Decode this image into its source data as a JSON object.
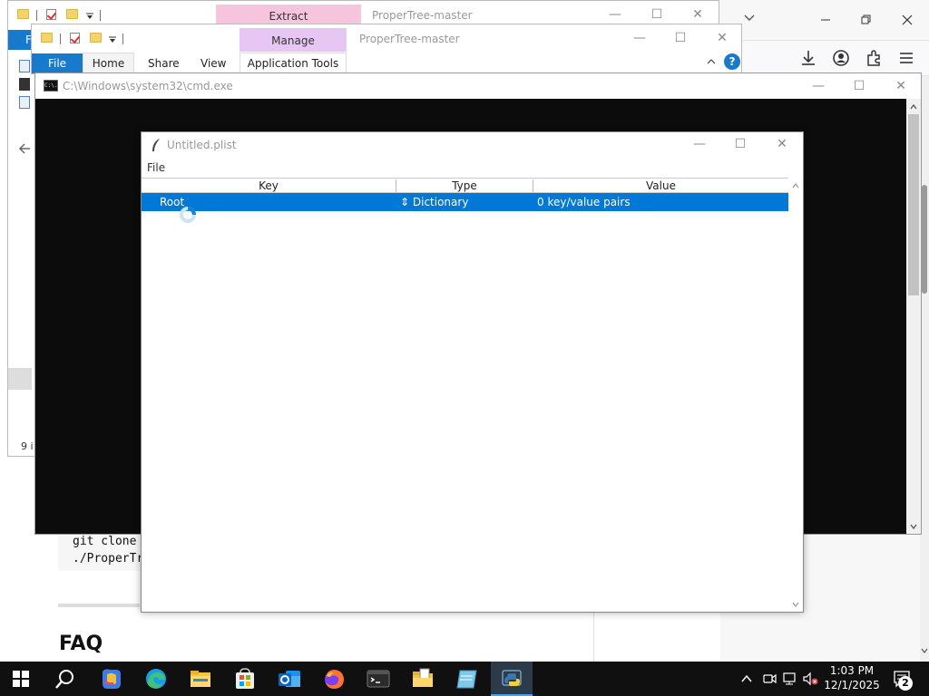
{
  "explorer_back": {
    "contextual_tab": "Extract",
    "title": "ProperTree-master",
    "tab_file_partial": "F",
    "status_partial": "9 i"
  },
  "explorer_front": {
    "contextual_tab": "Manage",
    "title": "ProperTree-master",
    "tabs": [
      "File",
      "Home",
      "Share",
      "View",
      "Application Tools"
    ]
  },
  "cmd": {
    "title": "C:\\Windows\\system32\\cmd.exe",
    "icon_text": "C:\\."
  },
  "webpage": {
    "code_line1": "git clone",
    "code_line2": "./ProperTr",
    "heading": "FAQ"
  },
  "propertree": {
    "title": "Untitled.plist",
    "menu_file": "File",
    "columns": [
      "Key",
      "Type",
      "Value"
    ],
    "rows": [
      {
        "key": "Root",
        "type": "⇕ Dictionary",
        "value": "0 key/value pairs",
        "selected": true
      }
    ]
  },
  "taskbar": {
    "time": "1:03 PM",
    "date": "12/1/2025",
    "notification_count": "2"
  },
  "colors": {
    "selection": "#0078d7",
    "taskbar_bg": "#101010",
    "cmd_bg": "#0c0c0c",
    "manage_tab": "#e8c6f4",
    "extract_tab": "#f6c4dc",
    "file_tab": "#1979ca"
  }
}
